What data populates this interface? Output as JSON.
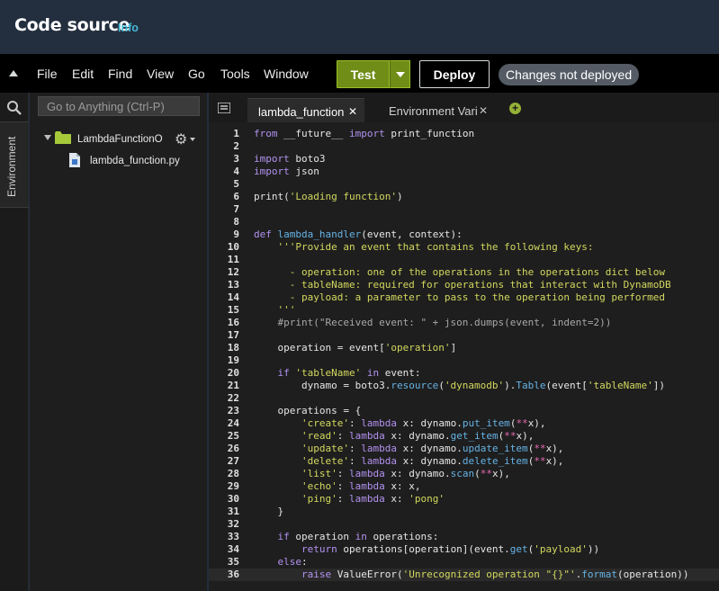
{
  "header": {
    "title": "Code source",
    "info_link": "Info"
  },
  "toolbar": {
    "menu": [
      "File",
      "Edit",
      "Find",
      "View",
      "Go",
      "Tools",
      "Window"
    ],
    "test_label": "Test",
    "deploy_label": "Deploy",
    "status_badge": "Changes not deployed"
  },
  "sidebar": {
    "environment_label": "Environment",
    "search_placeholder": "Go to Anything (Ctrl-P)"
  },
  "tree": {
    "folder": "LambdaFunctionOverview",
    "file": "lambda_function.py"
  },
  "tabs": [
    {
      "label": "lambda_function",
      "active": true
    },
    {
      "label": "Environment Variables",
      "active": false
    }
  ],
  "code_lines": [
    "from __future__ import print_function",
    "",
    "import boto3",
    "import json",
    "",
    "print('Loading function')",
    "",
    "",
    "def lambda_handler(event, context):",
    "    '''Provide an event that contains the following keys:",
    "",
    "      - operation: one of the operations in the operations dict below",
    "      - tableName: required for operations that interact with DynamoDB",
    "      - payload: a parameter to pass to the operation being performed",
    "    '''",
    "    #print(\"Received event: \" + json.dumps(event, indent=2))",
    "",
    "    operation = event['operation']",
    "",
    "    if 'tableName' in event:",
    "        dynamo = boto3.resource('dynamodb').Table(event['tableName'])",
    "",
    "    operations = {",
    "        'create': lambda x: dynamo.put_item(**x),",
    "        'read': lambda x: dynamo.get_item(**x),",
    "        'update': lambda x: dynamo.update_item(**x),",
    "        'delete': lambda x: dynamo.delete_item(**x),",
    "        'list': lambda x: dynamo.scan(**x),",
    "        'echo': lambda x: x,",
    "        'ping': lambda x: 'pong'",
    "    }",
    "",
    "    if operation in operations:",
    "        return operations[operation](event.get('payload'))",
    "    else:",
    "        raise ValueError('Unrecognized operation \"{}\"'.format(operation))"
  ],
  "current_line": 36,
  "colors": {
    "test_button": "#6f8d17",
    "header_bg": "#232f3e",
    "editor_bg": "#1e1e1e"
  }
}
